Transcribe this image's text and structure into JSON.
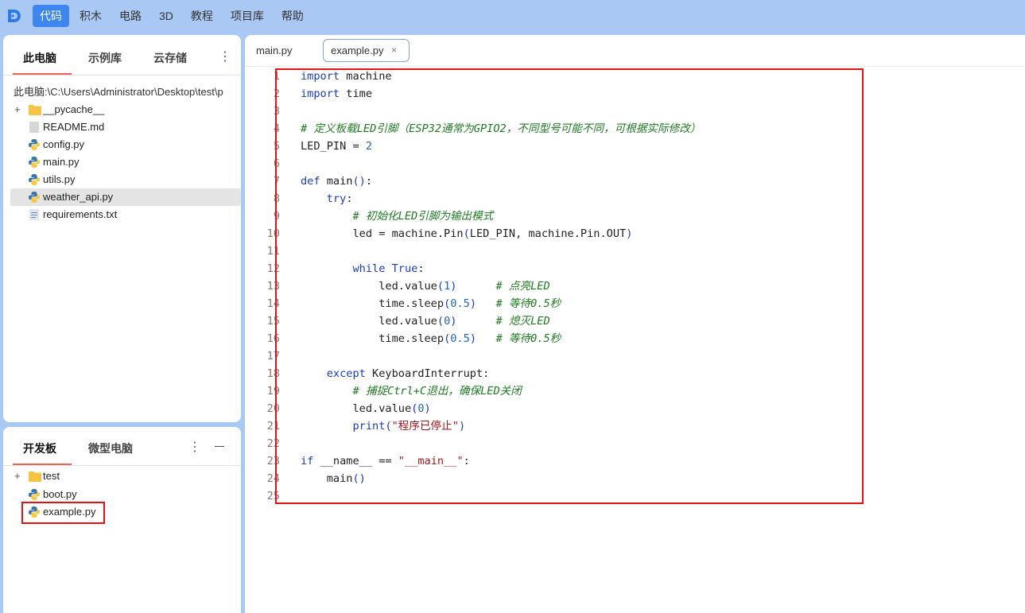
{
  "nav": {
    "items": [
      {
        "label": "代码",
        "active": true
      },
      {
        "label": "积木",
        "active": false
      },
      {
        "label": "电路",
        "active": false
      },
      {
        "label": "3D",
        "active": false
      },
      {
        "label": "教程",
        "active": false
      },
      {
        "label": "项目库",
        "active": false
      },
      {
        "label": "帮助",
        "active": false
      }
    ]
  },
  "files_panel": {
    "tabs": [
      "此电脑",
      "示例库",
      "云存储"
    ],
    "active_tab": "此电脑",
    "path": "此电脑:\\C:\\Users\\Administrator\\Desktop\\test\\p",
    "items": [
      {
        "name": "__pycache__",
        "type": "folder",
        "expandable": true
      },
      {
        "name": "README.md",
        "type": "file"
      },
      {
        "name": "config.py",
        "type": "python"
      },
      {
        "name": "main.py",
        "type": "python"
      },
      {
        "name": "utils.py",
        "type": "python"
      },
      {
        "name": "weather_api.py",
        "type": "python",
        "selected": true
      },
      {
        "name": "requirements.txt",
        "type": "text"
      }
    ]
  },
  "board_panel": {
    "tabs": [
      "开发板",
      "微型电脑"
    ],
    "active_tab": "开发板",
    "items": [
      {
        "name": "test",
        "type": "folder",
        "expandable": true
      },
      {
        "name": "boot.py",
        "type": "python"
      },
      {
        "name": "example.py",
        "type": "python",
        "highlighted": true
      }
    ]
  },
  "editor": {
    "tabs": [
      {
        "label": "main.py",
        "active": false
      },
      {
        "label": "example.py",
        "active": true,
        "close": "×"
      }
    ],
    "code_lines": [
      "import machine",
      "import time",
      "",
      "# 定义板载LED引脚（ESP32通常为GPIO2，不同型号可能不同，可根据实际修改）",
      "LED_PIN = 2",
      "",
      "def main():",
      "    try:",
      "        # 初始化LED引脚为输出模式",
      "        led = machine.Pin(LED_PIN, machine.Pin.OUT)",
      "",
      "        while True:",
      "            led.value(1)      # 点亮LED",
      "            time.sleep(0.5)   # 等待0.5秒",
      "            led.value(0)      # 熄灭LED",
      "            time.sleep(0.5)   # 等待0.5秒",
      "",
      "    except KeyboardInterrupt:",
      "        # 捕捉Ctrl+C退出，确保LED关闭",
      "        led.value(0)",
      "        print(\"程序已停止\")",
      "",
      "if __name__ == \"__main__\":",
      "    main()",
      ""
    ]
  },
  "colors": {
    "background": "#a9c8f3",
    "accent": "#3d86f0",
    "keyword": "#1b3cc4",
    "comment": "#1f7a22",
    "string": "#a3181d",
    "number": "#1e66b8",
    "highlight": "#e01414",
    "tab_underline": "#e8645a"
  }
}
